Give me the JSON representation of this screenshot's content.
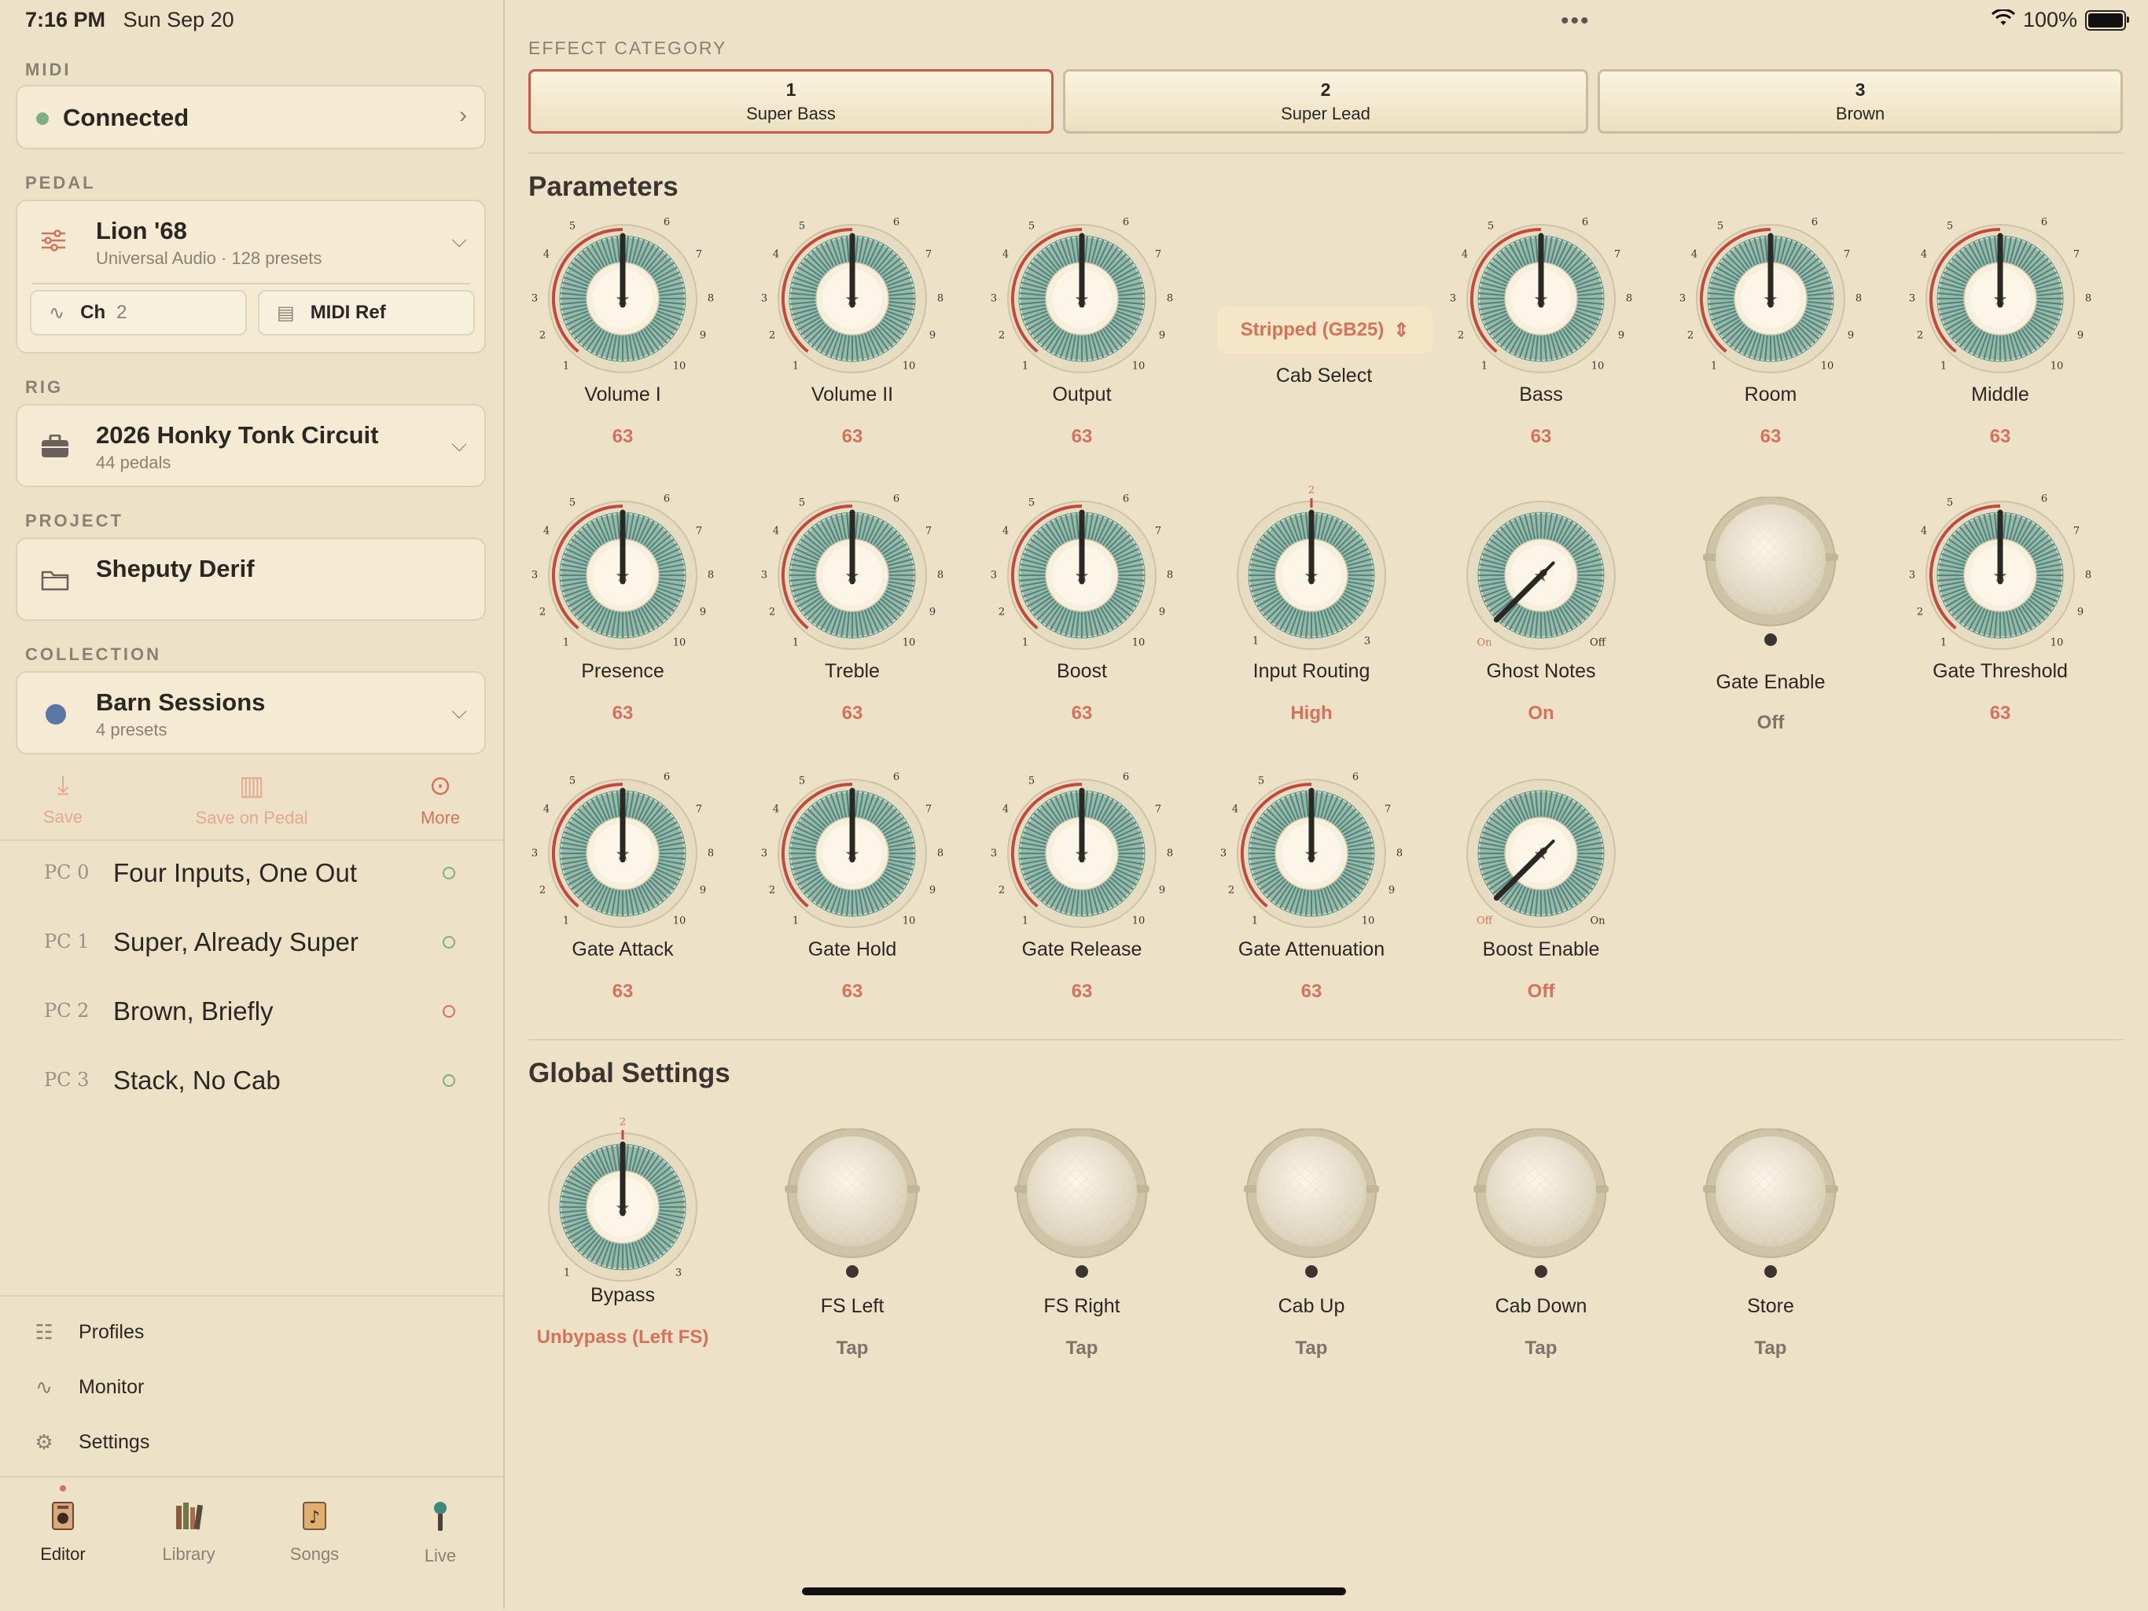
{
  "status": {
    "time": "7:16 PM",
    "date": "Sun Sep 20",
    "battery": "100%"
  },
  "sidebar": {
    "midi": {
      "label": "MIDI",
      "status": "Connected",
      "status_color": "#7fae84"
    },
    "pedal": {
      "label": "PEDAL",
      "name": "Lion '68",
      "sub": "Universal Audio · 128 presets",
      "channel_label": "Ch",
      "channel_value": "2",
      "midi_ref": "MIDI Ref"
    },
    "rig": {
      "label": "RIG",
      "name": "2026 Honky Tonk Circuit",
      "sub": "44 pedals"
    },
    "project": {
      "label": "PROJECT",
      "name": "Sheputy Derif"
    },
    "collection": {
      "label": "COLLECTION",
      "name": "Barn Sessions",
      "sub": "4 presets",
      "color": "#5a77a8"
    },
    "actions": [
      {
        "label": "Save",
        "icon": "tray-download-icon"
      },
      {
        "label": "Save on Pedal",
        "icon": "chip-icon"
      },
      {
        "label": "More",
        "icon": "ellipsis-circle-icon"
      }
    ],
    "presets": [
      {
        "pc": "PC 0",
        "name": "Four Inputs, One Out",
        "state": "green"
      },
      {
        "pc": "PC 1",
        "name": "Super, Already Super",
        "state": "green"
      },
      {
        "pc": "PC 2",
        "name": "Brown, Briefly",
        "state": "red"
      },
      {
        "pc": "PC 3",
        "name": "Stack, No Cab",
        "state": "green"
      }
    ],
    "links": [
      {
        "label": "Profiles",
        "icon": "profiles-icon"
      },
      {
        "label": "Monitor",
        "icon": "waveform-icon"
      },
      {
        "label": "Settings",
        "icon": "gear-icon"
      }
    ],
    "tabs": [
      {
        "label": "Editor",
        "icon": "amp-icon"
      },
      {
        "label": "Library",
        "icon": "books-icon"
      },
      {
        "label": "Songs",
        "icon": "music-note-icon"
      },
      {
        "label": "Live",
        "icon": "microphone-icon"
      }
    ]
  },
  "main": {
    "category_label": "EFFECT CATEGORY",
    "categories": [
      {
        "num": "1",
        "name": "Super Bass",
        "selected": true
      },
      {
        "num": "2",
        "name": "Super Lead",
        "selected": false
      },
      {
        "num": "3",
        "name": "Brown",
        "selected": false
      }
    ],
    "parameters_title": "Parameters",
    "cab_select": {
      "value": "Stripped (GB25)",
      "label": "Cab Select"
    },
    "parameters": [
      {
        "label": "Volume I",
        "value": "63"
      },
      {
        "label": "Volume II",
        "value": "63"
      },
      {
        "label": "Output",
        "value": "63"
      },
      {
        "label": "Bass",
        "value": "63"
      },
      {
        "label": "Room",
        "value": "63"
      },
      {
        "label": "Middle",
        "value": "63"
      },
      {
        "label": "Presence",
        "value": "63"
      },
      {
        "label": "Treble",
        "value": "63"
      },
      {
        "label": "Boost",
        "value": "63"
      },
      {
        "label": "Input Routing",
        "value": "High"
      },
      {
        "label": "Ghost Notes",
        "value": "On"
      },
      {
        "label": "Gate Enable",
        "value": "Off"
      },
      {
        "label": "Gate Threshold",
        "value": "63"
      },
      {
        "label": "Gate Attack",
        "value": "63"
      },
      {
        "label": "Gate Hold",
        "value": "63"
      },
      {
        "label": "Gate Release",
        "value": "63"
      },
      {
        "label": "Gate Attenuation",
        "value": "63"
      },
      {
        "label": "Boost Enable",
        "value": "Off"
      }
    ],
    "scale_ticks": [
      "1",
      "2",
      "3",
      "4",
      "5",
      "6",
      "7",
      "8",
      "9",
      "10"
    ],
    "routing_ticks": [
      "1",
      "2",
      "3"
    ],
    "switch_ticks": {
      "on": "On",
      "off": "Off"
    },
    "global_title": "Global Settings",
    "globals": [
      {
        "label": "Bypass",
        "value": "Unbypass (Left FS)"
      },
      {
        "label": "FS Left",
        "value": "Tap"
      },
      {
        "label": "FS Right",
        "value": "Tap"
      },
      {
        "label": "Cab Up",
        "value": "Tap"
      },
      {
        "label": "Cab Down",
        "value": "Tap"
      },
      {
        "label": "Store",
        "value": "Tap"
      }
    ],
    "colors": {
      "accent": "#d4735d",
      "knob_teal": "#5f9c94",
      "arc_red": "#c24a3c"
    }
  }
}
